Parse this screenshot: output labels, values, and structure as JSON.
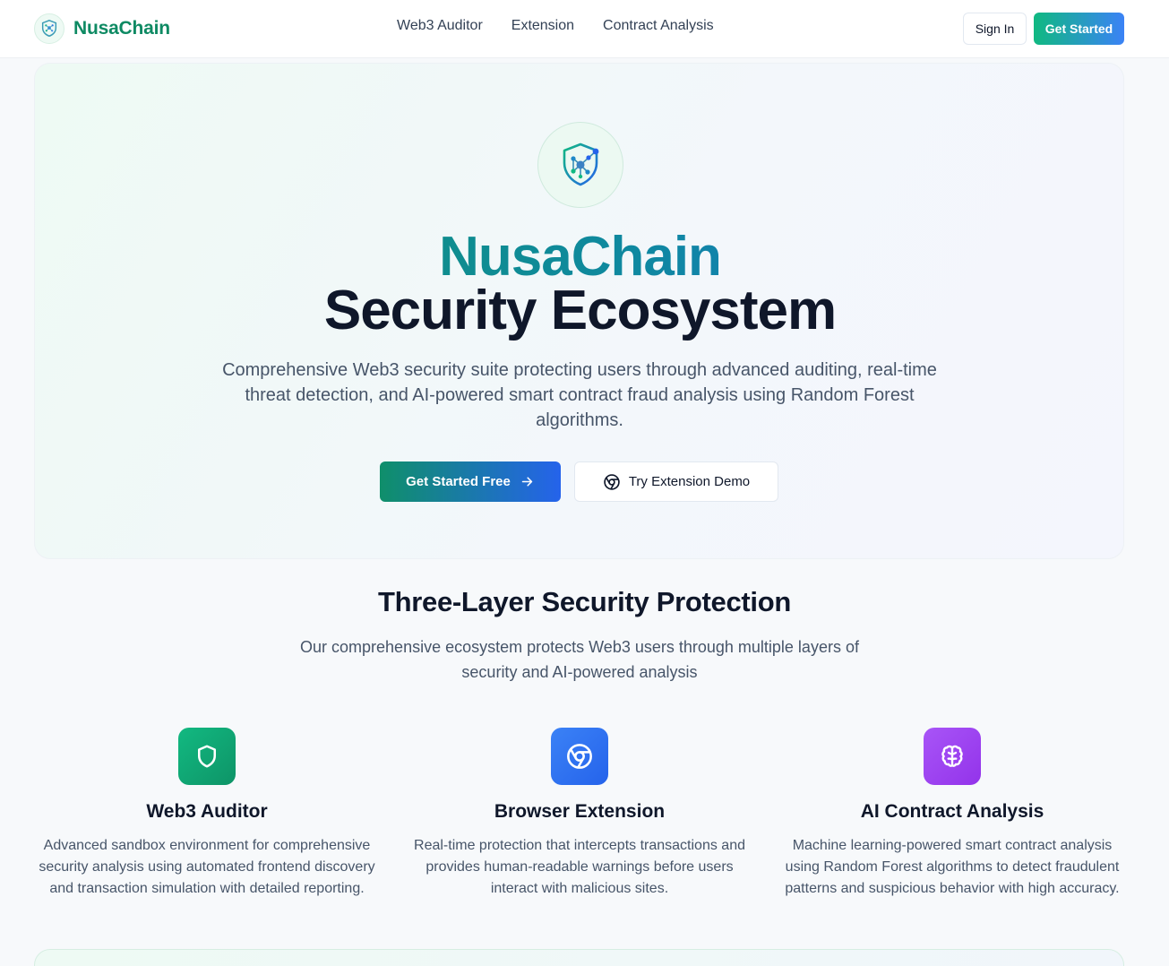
{
  "header": {
    "brand": "NusaChain",
    "nav": [
      {
        "label": "Web3 Auditor"
      },
      {
        "label": "Extension"
      },
      {
        "label": "Contract Analysis"
      }
    ],
    "sign_in": "Sign In",
    "get_started": "Get Started"
  },
  "hero": {
    "title_brand": "NusaChain",
    "title_main": "Security Ecosystem",
    "subtitle": "Comprehensive Web3 security suite protecting users through advanced auditing, real-time threat detection, and AI-powered smart contract fraud analysis using Random Forest algorithms.",
    "cta_primary": "Get Started Free",
    "cta_secondary": "Try Extension Demo"
  },
  "features_section": {
    "title": "Three-Layer Security Protection",
    "subtitle": "Our comprehensive ecosystem protects Web3 users through multiple layers of security and AI-powered analysis",
    "items": [
      {
        "title": "Web3 Auditor",
        "description": "Advanced sandbox environment for comprehensive security analysis using automated frontend discovery and transaction simulation with detailed reporting.",
        "icon": "shield-icon",
        "color": "#10b981"
      },
      {
        "title": "Browser Extension",
        "description": "Real-time protection that intercepts transactions and provides human-readable warnings before users interact with malicious sites.",
        "icon": "chrome-icon",
        "color": "#3b82f6"
      },
      {
        "title": "AI Contract Analysis",
        "description": "Machine learning-powered smart contract analysis using Random Forest algorithms to detect fraudulent patterns and suspicious behavior with high accuracy.",
        "icon": "brain-icon",
        "color": "#9333ea"
      }
    ]
  },
  "colors": {
    "brand_green": "#0e8a63",
    "brand_blue": "#2563eb",
    "text_dark": "#0f172a",
    "text_muted": "#475569"
  }
}
